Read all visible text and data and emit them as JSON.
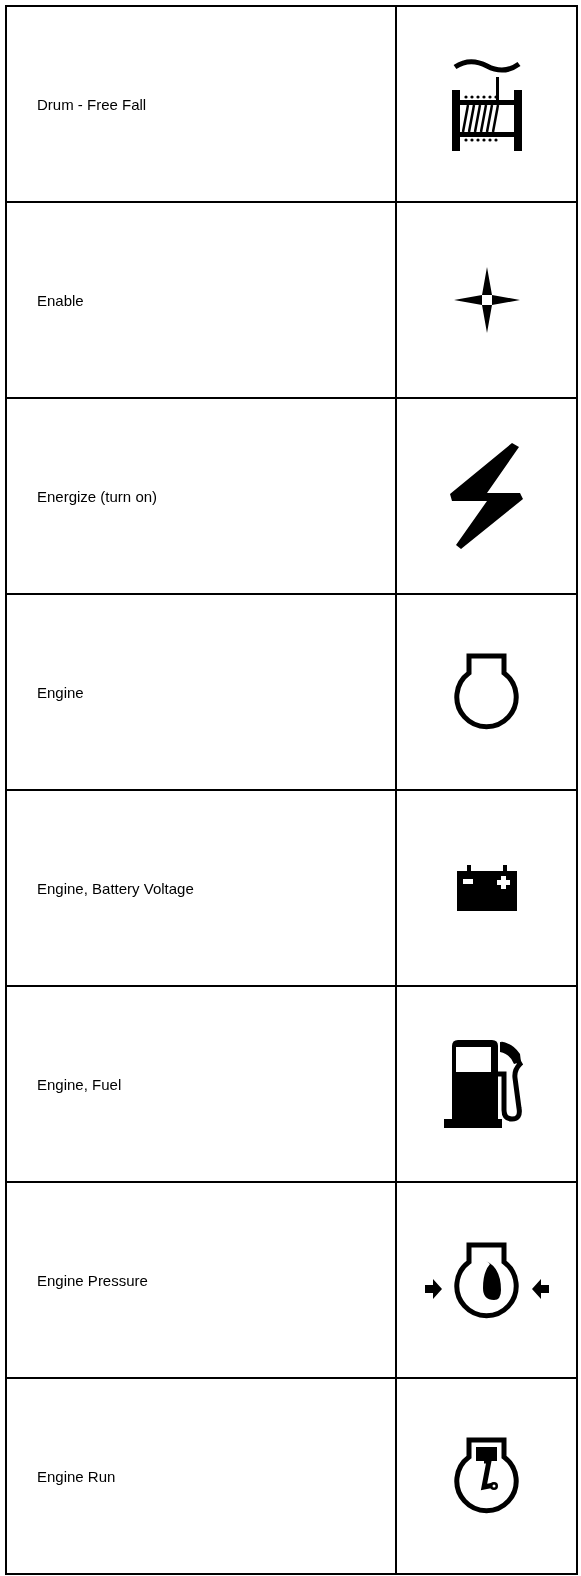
{
  "rows": [
    {
      "label": "Drum - Free Fall",
      "kind": "drum"
    },
    {
      "label": "Enable",
      "kind": "star"
    },
    {
      "label": "Energize (turn on)",
      "kind": "bolt"
    },
    {
      "label": "Engine",
      "kind": "engine"
    },
    {
      "label": "Engine, Battery Voltage",
      "kind": "battery"
    },
    {
      "label": "Engine, Fuel",
      "kind": "fuel"
    },
    {
      "label": "Engine Pressure",
      "kind": "pressure"
    },
    {
      "label": "Engine Run",
      "kind": "run"
    }
  ]
}
